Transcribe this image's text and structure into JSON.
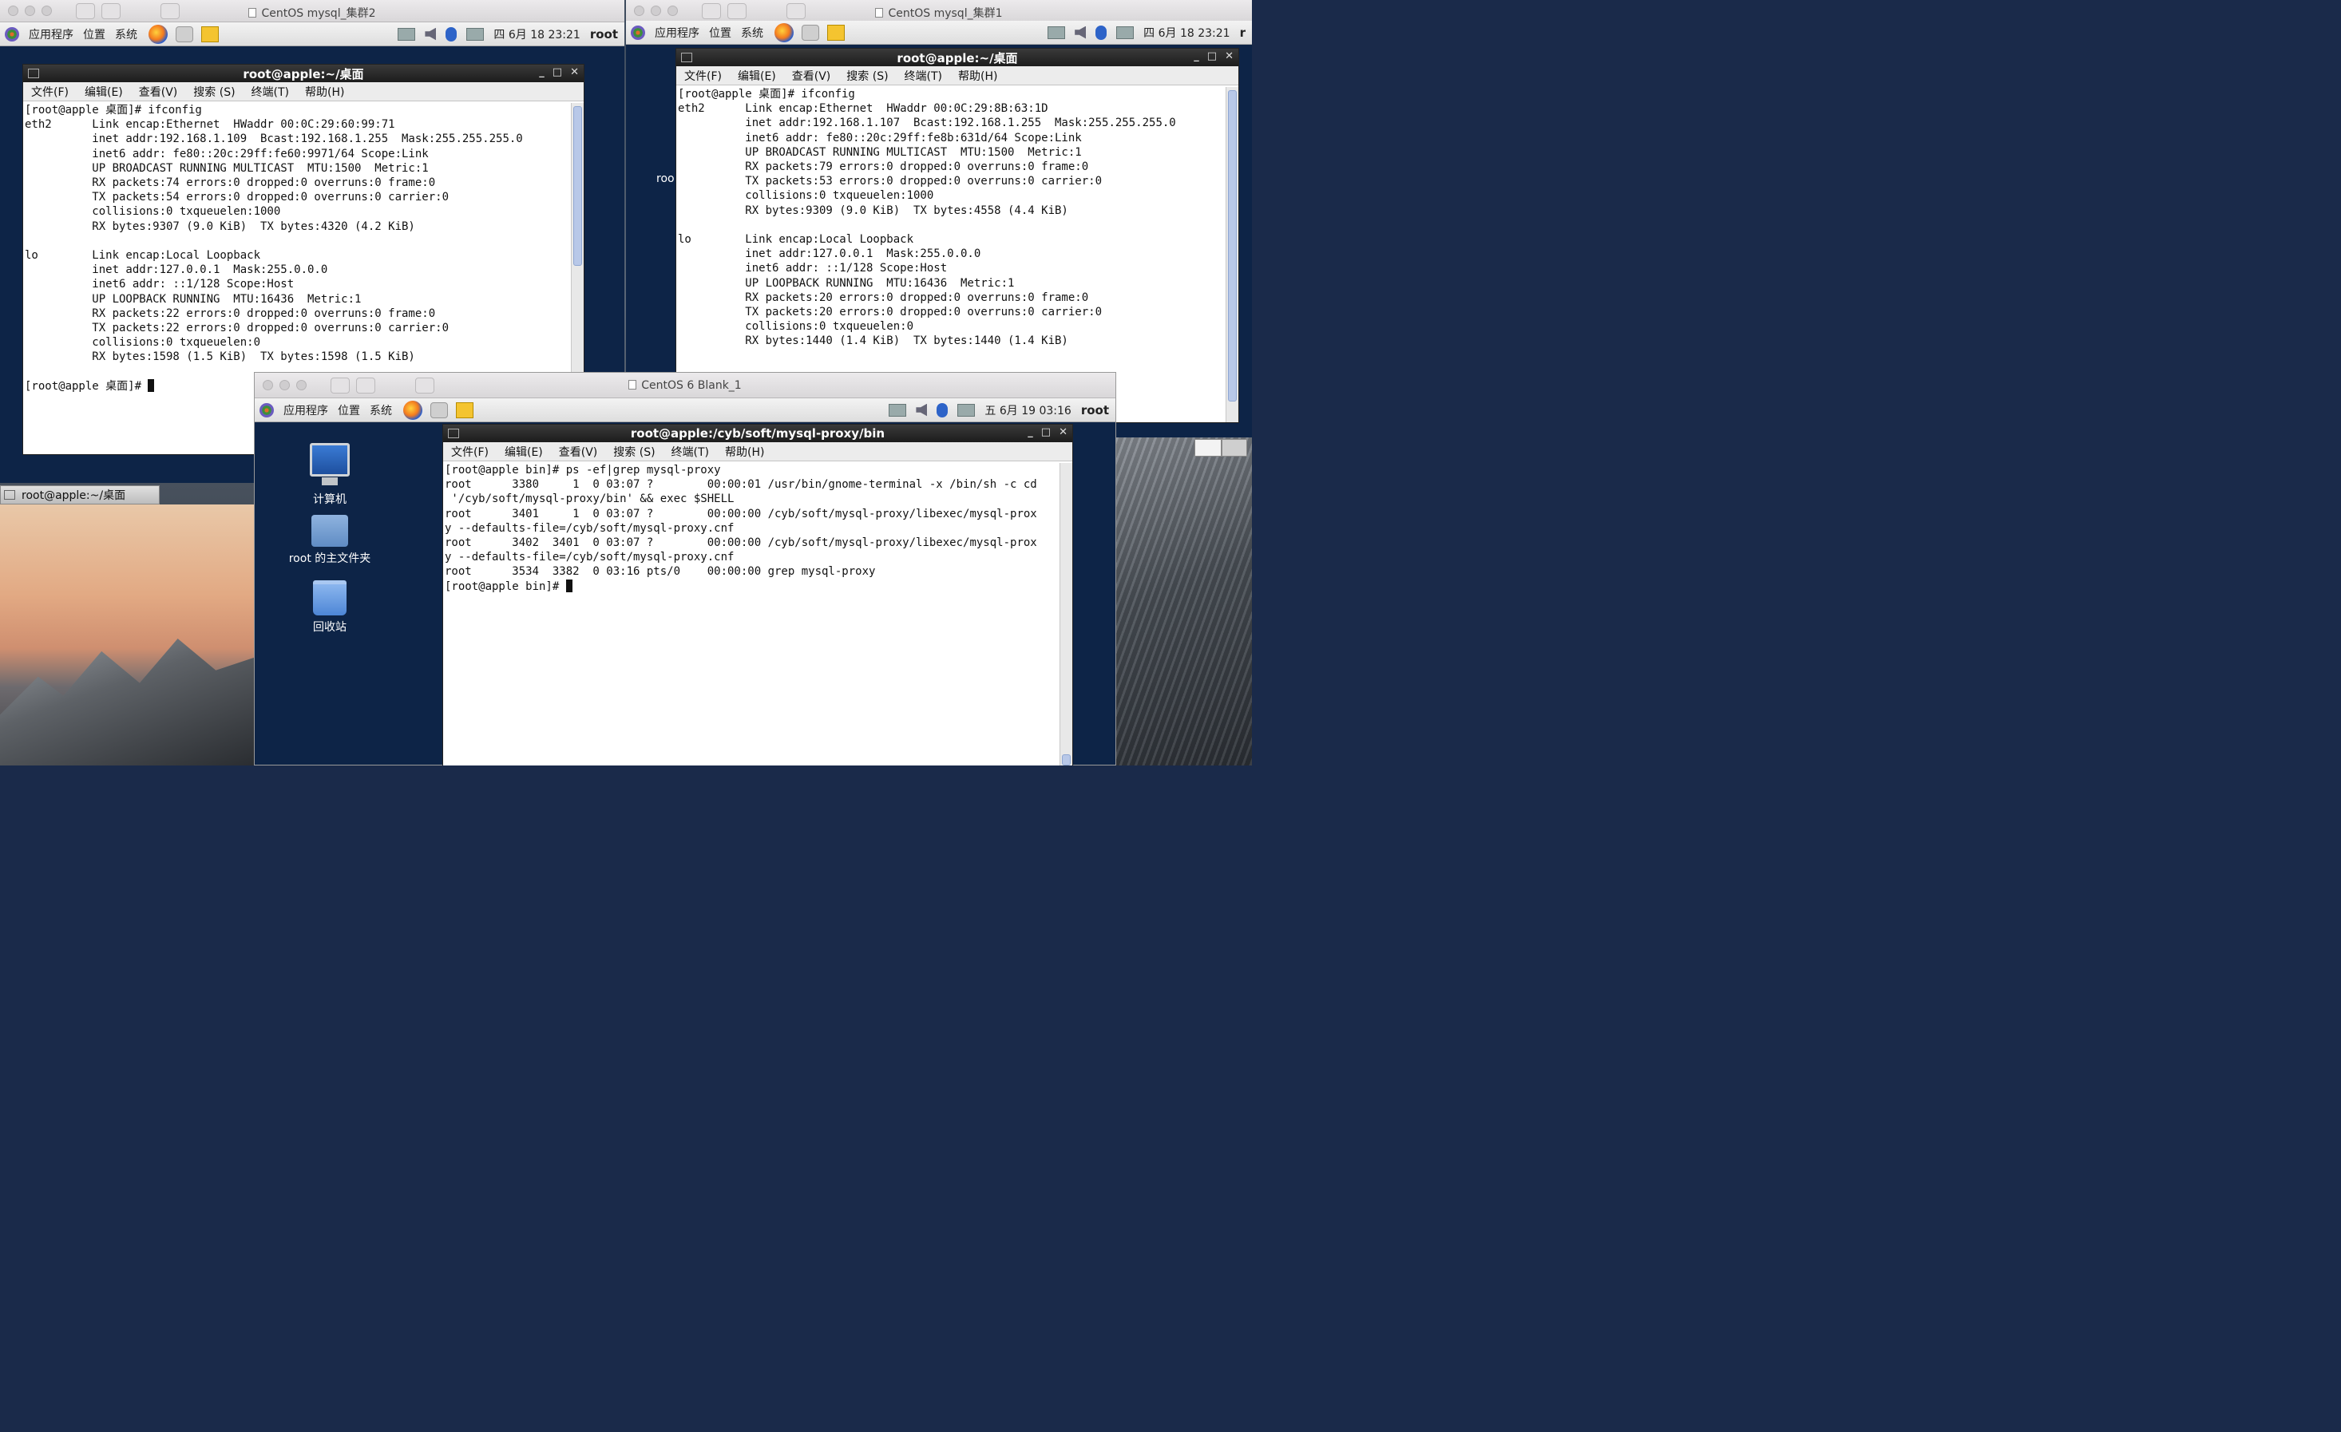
{
  "vm_left": {
    "window_title": "CentOS mysql_集群2",
    "panel": {
      "apps": "应用程序",
      "places": "位置",
      "system": "系统",
      "clock": "四 6月 18 23:21",
      "user": "root"
    },
    "terminal": {
      "title": "root@apple:~/桌面",
      "menu": [
        "文件(F)",
        "编辑(E)",
        "查看(V)",
        "搜索 (S)",
        "终端(T)",
        "帮助(H)"
      ],
      "lines": [
        "[root@apple 桌面]# ifconfig",
        "eth2      Link encap:Ethernet  HWaddr 00:0C:29:60:99:71",
        "          inet addr:192.168.1.109  Bcast:192.168.1.255  Mask:255.255.255.0",
        "          inet6 addr: fe80::20c:29ff:fe60:9971/64 Scope:Link",
        "          UP BROADCAST RUNNING MULTICAST  MTU:1500  Metric:1",
        "          RX packets:74 errors:0 dropped:0 overruns:0 frame:0",
        "          TX packets:54 errors:0 dropped:0 overruns:0 carrier:0",
        "          collisions:0 txqueuelen:1000",
        "          RX bytes:9307 (9.0 KiB)  TX bytes:4320 (4.2 KiB)",
        "",
        "lo        Link encap:Local Loopback",
        "          inet addr:127.0.0.1  Mask:255.0.0.0",
        "          inet6 addr: ::1/128 Scope:Host",
        "          UP LOOPBACK RUNNING  MTU:16436  Metric:1",
        "          RX packets:22 errors:0 dropped:0 overruns:0 frame:0",
        "          TX packets:22 errors:0 dropped:0 overruns:0 carrier:0",
        "          collisions:0 txqueuelen:0",
        "          RX bytes:1598 (1.5 KiB)  TX bytes:1598 (1.5 KiB)",
        ""
      ],
      "prompt": "[root@apple 桌面]# "
    },
    "minimized_title": "root@apple:~/桌面"
  },
  "vm_right": {
    "window_title": "CentOS mysql_集群1",
    "panel": {
      "apps": "应用程序",
      "places": "位置",
      "system": "系统",
      "clock": "四 6月 18 23:21",
      "user": "r"
    },
    "side_text": "roo",
    "terminal": {
      "title": "root@apple:~/桌面",
      "menu": [
        "文件(F)",
        "编辑(E)",
        "查看(V)",
        "搜索 (S)",
        "终端(T)",
        "帮助(H)"
      ],
      "lines": [
        "[root@apple 桌面]# ifconfig",
        "eth2      Link encap:Ethernet  HWaddr 00:0C:29:8B:63:1D",
        "          inet addr:192.168.1.107  Bcast:192.168.1.255  Mask:255.255.255.0",
        "          inet6 addr: fe80::20c:29ff:fe8b:631d/64 Scope:Link",
        "          UP BROADCAST RUNNING MULTICAST  MTU:1500  Metric:1",
        "          RX packets:79 errors:0 dropped:0 overruns:0 frame:0",
        "          TX packets:53 errors:0 dropped:0 overruns:0 carrier:0",
        "          collisions:0 txqueuelen:1000",
        "          RX bytes:9309 (9.0 KiB)  TX bytes:4558 (4.4 KiB)",
        "",
        "lo        Link encap:Local Loopback",
        "          inet addr:127.0.0.1  Mask:255.0.0.0",
        "          inet6 addr: ::1/128 Scope:Host",
        "          UP LOOPBACK RUNNING  MTU:16436  Metric:1",
        "          RX packets:20 errors:0 dropped:0 overruns:0 frame:0",
        "          TX packets:20 errors:0 dropped:0 overruns:0 carrier:0",
        "          collisions:0 txqueuelen:0",
        "          RX bytes:1440 (1.4 KiB)  TX bytes:1440 (1.4 KiB)"
      ]
    }
  },
  "vm_front": {
    "window_title": "CentOS 6 Blank_1",
    "panel": {
      "apps": "应用程序",
      "places": "位置",
      "system": "系统",
      "clock": "五 6月 19 03:16",
      "user": "root"
    },
    "desktop_icons": [
      "计算机",
      "root 的主文件夹",
      "回收站"
    ],
    "terminal": {
      "title": "root@apple:/cyb/soft/mysql-proxy/bin",
      "menu": [
        "文件(F)",
        "编辑(E)",
        "查看(V)",
        "搜索 (S)",
        "终端(T)",
        "帮助(H)"
      ],
      "lines": [
        "[root@apple bin]# ps -ef|grep mysql-proxy",
        "root      3380     1  0 03:07 ?        00:00:01 /usr/bin/gnome-terminal -x /bin/sh -c cd",
        " '/cyb/soft/mysql-proxy/bin' && exec $SHELL",
        "root      3401     1  0 03:07 ?        00:00:00 /cyb/soft/mysql-proxy/libexec/mysql-prox",
        "y --defaults-file=/cyb/soft/mysql-proxy.cnf",
        "root      3402  3401  0 03:07 ?        00:00:00 /cyb/soft/mysql-proxy/libexec/mysql-prox",
        "y --defaults-file=/cyb/soft/mysql-proxy.cnf",
        "root      3534  3382  0 03:16 pts/0    00:00:00 grep mysql-proxy"
      ],
      "prompt": "[root@apple bin]# "
    }
  },
  "colors": {
    "vm_bg": "#0d2447",
    "term_title": "#2a2a2a",
    "terminal_bg": "#ffffff"
  }
}
